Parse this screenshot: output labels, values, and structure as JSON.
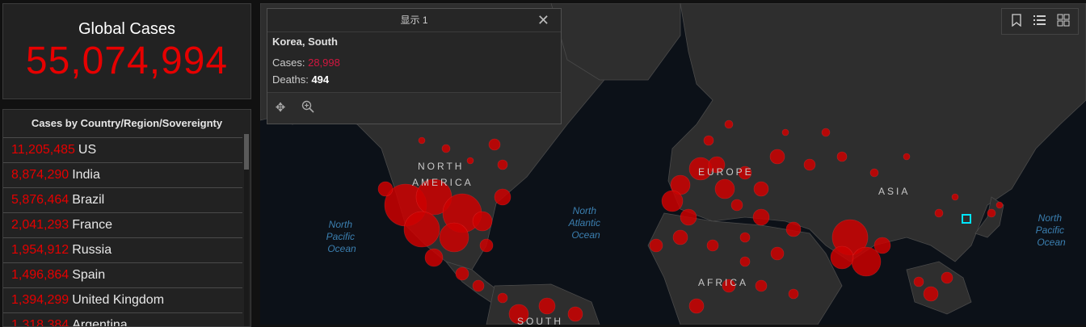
{
  "total": {
    "title": "Global Cases",
    "value": "55,074,994"
  },
  "list": {
    "title": "Cases by Country/Region/Sovereignty",
    "rows": [
      {
        "count": "11,205,485",
        "name": "US"
      },
      {
        "count": "8,874,290",
        "name": "India"
      },
      {
        "count": "5,876,464",
        "name": "Brazil"
      },
      {
        "count": "2,041,293",
        "name": "France"
      },
      {
        "count": "1,954,912",
        "name": "Russia"
      },
      {
        "count": "1,496,864",
        "name": "Spain"
      },
      {
        "count": "1,394,299",
        "name": "United Kingdom"
      },
      {
        "count": "1,318,384",
        "name": "Argentina"
      }
    ]
  },
  "map": {
    "regions": {
      "north_america": "NORTH",
      "north_america_2": "AMERICA",
      "europe": "EUROPE",
      "asia": "ASIA",
      "africa": "AFRICA",
      "south_america": "SOUTH"
    },
    "oceans": {
      "north_pacific_left": [
        "North",
        "Pacific",
        "Ocean"
      ],
      "north_atlantic": [
        "North",
        "Atlantic",
        "Ocean"
      ],
      "north_pacific_right": [
        "North",
        "Pacific",
        "Ocean"
      ]
    },
    "marker_color": "#cc0000",
    "land_color": "#2e2e2e",
    "water_color": "#0c1118"
  },
  "popup": {
    "header": "显示 1",
    "title": "Korea, South",
    "cases_label": "Cases:",
    "cases_value": "28,998",
    "deaths_label": "Deaths:",
    "deaths_value": "494",
    "close_icon": "close-icon",
    "footer_icons": [
      "pan-icon",
      "zoom-to-icon"
    ]
  },
  "toolbar": {
    "icons": [
      "bookmark-icon",
      "legend-list-icon",
      "basemap-gallery-icon"
    ]
  },
  "colors": {
    "accent": "#e60000",
    "cases_popup": "#d2163f",
    "selection": "#00e5ff"
  }
}
